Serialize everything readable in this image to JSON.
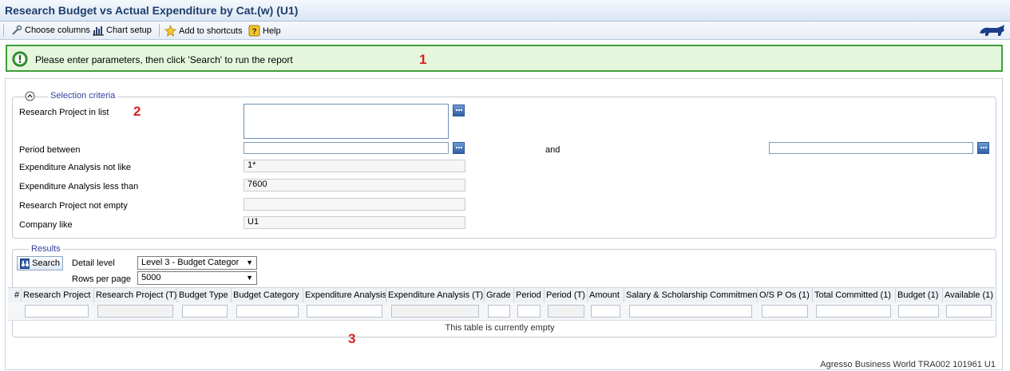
{
  "window": {
    "title": "Research Budget vs Actual Expenditure by Cat.(w) (U1)"
  },
  "toolbar": {
    "choose_columns": "Choose columns",
    "chart_setup": "Chart setup",
    "add_shortcuts": "Add to shortcuts",
    "help": "Help"
  },
  "message": {
    "text": "Please enter parameters, then click 'Search' to run the report"
  },
  "annotations": {
    "n1": "1",
    "n2": "2",
    "n3": "3"
  },
  "selection": {
    "legend": "Selection criteria",
    "research_project_label": "Research Project in list",
    "research_project_value": "",
    "period_label": "Period between",
    "period_from": "",
    "period_and": "and",
    "period_to": "",
    "exp_not_like_label": "Expenditure Analysis not like",
    "exp_not_like_value": "1*",
    "exp_less_than_label": "Expenditure Analysis less than",
    "exp_less_than_value": "7600",
    "rp_not_empty_label": "Research Project not empty",
    "rp_not_empty_value": "",
    "company_label": "Company like",
    "company_value": "U1"
  },
  "results": {
    "legend": "Results",
    "search_button": "Search",
    "detail_level_label": "Detail level",
    "detail_level_value": "Level 3 - Budget Categor",
    "rows_per_page_label": "Rows per page",
    "rows_per_page_value": "5000",
    "columns": [
      "#",
      "Research Project",
      "Research Project (T)",
      "Budget Type",
      "Budget Category",
      "Expenditure Analysis",
      "Expenditure Analysis (T)",
      "Grade",
      "Period",
      "Period (T)",
      "Amount",
      "Salary & Scholarship Commitment",
      "O/S P Os (1)",
      "Total Committed (1)",
      "Budget (1)",
      "Available (1)"
    ],
    "empty_text": "This table is currently empty"
  },
  "footer": {
    "text": "Agresso Business World   TRA002   101961   U1"
  },
  "colors": {
    "title": "#1f3e6c",
    "message_border": "#3f9e3a",
    "message_bg": "#e4f7dc",
    "annotation": "#d81e1e",
    "legend": "#2f3f9e"
  }
}
